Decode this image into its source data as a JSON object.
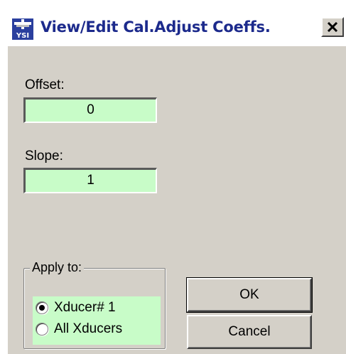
{
  "window": {
    "title": "View/Edit Cal.Adjust Coeffs.",
    "app_icon": "ysi-icon",
    "close_icon": "close-icon"
  },
  "offset": {
    "label": "Offset:",
    "value": "0"
  },
  "slope": {
    "label": "Slope:",
    "value": "1"
  },
  "apply_to": {
    "legend": "Apply to:",
    "options": [
      {
        "label": "Xducer# 1",
        "selected": true
      },
      {
        "label": "All Xducers",
        "selected": false
      }
    ]
  },
  "buttons": {
    "ok_label": "OK",
    "cancel_label": "Cancel"
  },
  "colors": {
    "field_bg": "#c8fcc8",
    "dialog_bg": "#d4d0c8",
    "title_text": "#1c2a8c"
  }
}
